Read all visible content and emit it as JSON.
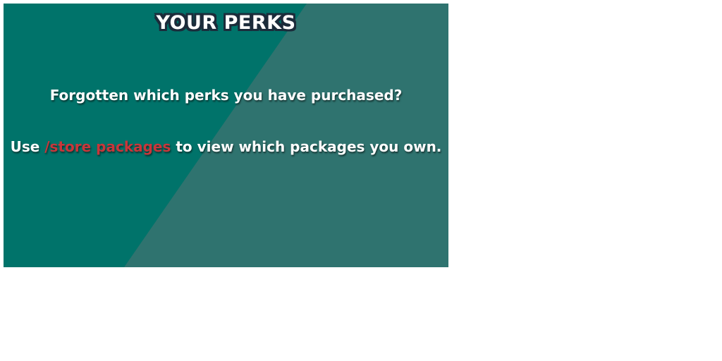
{
  "panel": {
    "title": "YOUR PERKS",
    "question": "Forgotten which perks you have purchased?",
    "instruction": {
      "prefix": "Use ",
      "command": "/store packages",
      "suffix": " to view which packages you own."
    }
  },
  "colors": {
    "panel_dark": "#00736a",
    "panel_light": "#2f736f",
    "command_text": "#c8363a",
    "title_outline": "#1fa8b8"
  }
}
